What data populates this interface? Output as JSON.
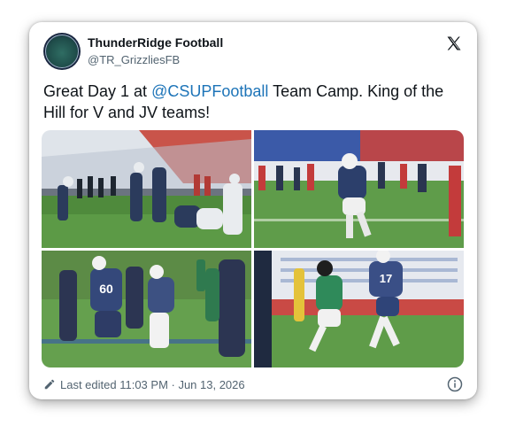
{
  "account": {
    "display_name": "ThunderRidge Football",
    "handle": "@TR_GrizzliesFB"
  },
  "tweet": {
    "text_before": "Great Day 1 at ",
    "mention": "@CSUPFootball",
    "text_after": " Team Camp. King of the Hill for V and JV teams!"
  },
  "media": {
    "photos": [
      {
        "jersey_numbers": []
      },
      {
        "jersey_numbers": []
      },
      {
        "jersey_numbers": [
          "60"
        ]
      },
      {
        "jersey_numbers": [
          "17"
        ]
      }
    ]
  },
  "footer": {
    "edited_label": "Last edited 11:03 PM · Jun 13, 2026"
  },
  "icons": {
    "brand": "x-logo-icon",
    "edit": "pencil-icon",
    "info": "info-icon"
  },
  "colors": {
    "mention": "#1d74b8",
    "name": "#0f1419",
    "secondary": "#536471"
  }
}
